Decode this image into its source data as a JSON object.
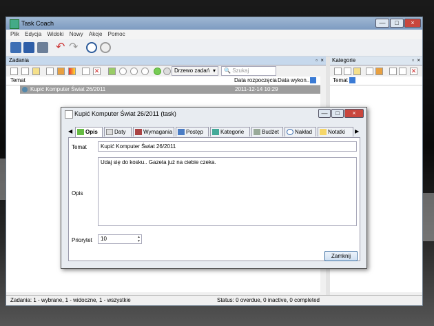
{
  "app": {
    "title": "Task Coach",
    "controls": {
      "minimize": "—",
      "maximize": "□",
      "close": "×"
    }
  },
  "menu": [
    "Plik",
    "Edycja",
    "Widoki",
    "Nowy",
    "Akcje",
    "Pomoc"
  ],
  "tasks_panel": {
    "title": "Zadania",
    "view_mode": "Drzewo zadań",
    "search_placeholder": "Szukaj",
    "columns": {
      "subject": "Temat",
      "start": "Data rozpoczęcia",
      "due": "Data wykon..."
    },
    "rows": [
      {
        "subject": "Kupić Komputer Świat 26/2011",
        "start": "2011-12-14 10:29",
        "due": ""
      }
    ]
  },
  "categories_panel": {
    "title": "Kategorie",
    "column": "Temat"
  },
  "statusbar": {
    "left": "Zadania: 1 - wybrane, 1 - widoczne, 1 - wszystkie",
    "right": "Status: 0 overdue, 0 inactive, 0 completed"
  },
  "dialog": {
    "title": "Kupić Komputer Świat 26/2011 (task)",
    "tabs": [
      "Opis",
      "Daty",
      "Wymagania",
      "Postęp",
      "Kategorie",
      "Budżet",
      "Nakład",
      "Notatki"
    ],
    "active_tab": "Opis",
    "subject_label": "Temat",
    "subject_value": "Kupić Komputer Świat 26/2011",
    "description_label": "Opis",
    "description_value": "Udaj się do kosku.. Gazeta już na ciebie czeka.",
    "priority_label": "Priorytet",
    "priority_value": "10",
    "close_button": "Zamknij"
  }
}
